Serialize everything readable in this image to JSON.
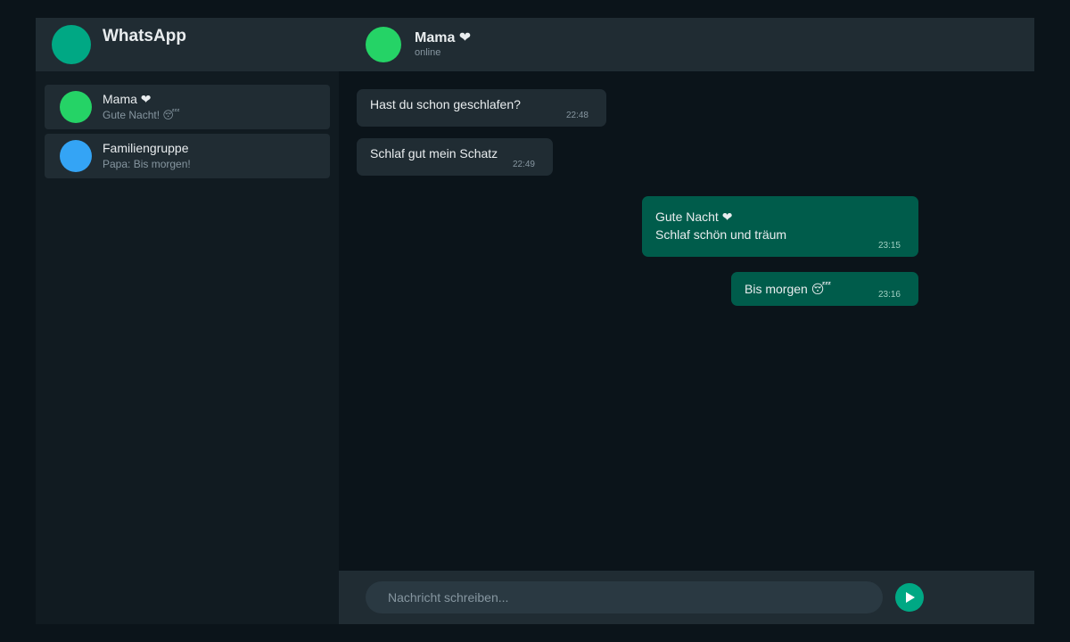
{
  "sidebar": {
    "app_title": "WhatsApp",
    "chats": [
      {
        "name": "Mama ❤",
        "preview": "Gute Nacht! 😴",
        "avatar_color": "#25d366"
      },
      {
        "name": "Familiengruppe",
        "preview": "Papa: Bis morgen!",
        "avatar_color": "#34a4f5"
      }
    ]
  },
  "chat": {
    "contact_name": "Mama ❤",
    "contact_status": "online",
    "messages": [
      {
        "direction": "in",
        "lines": [
          "Hast du schon geschlafen?"
        ],
        "time": "22:48"
      },
      {
        "direction": "in",
        "lines": [
          "Schlaf gut mein Schatz"
        ],
        "time": "22:49"
      },
      {
        "direction": "out",
        "lines": [
          "Gute Nacht ❤",
          "Schlaf schön und träum"
        ],
        "time": "23:15"
      },
      {
        "direction": "out",
        "lines": [
          "Bis morgen 😴"
        ],
        "time": "23:16"
      }
    ]
  },
  "composer": {
    "placeholder": "Nachricht schreiben..."
  },
  "colors": {
    "accent": "#00a884",
    "outgoing_bubble": "#005c4b",
    "incoming_bubble": "#202c33",
    "background": "#0b141a"
  },
  "icons": {
    "send": "send-icon"
  }
}
